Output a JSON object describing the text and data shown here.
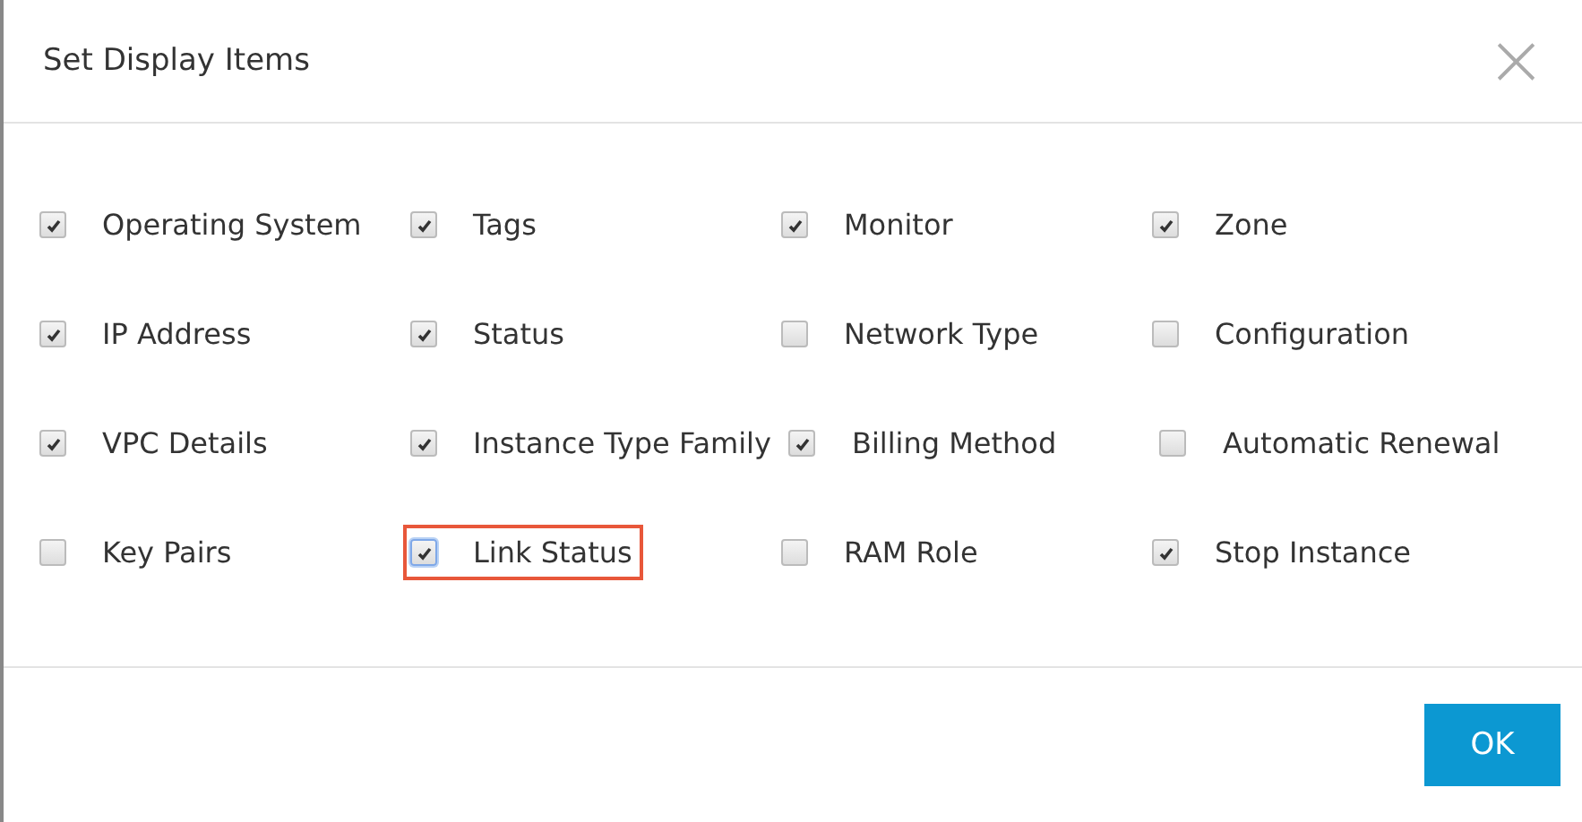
{
  "dialog": {
    "title": "Set Display Items",
    "close": "×"
  },
  "rows": [
    [
      {
        "label": "Operating System",
        "checked": true,
        "highlighted": false
      },
      {
        "label": "Tags",
        "checked": true,
        "highlighted": false
      },
      {
        "label": "Monitor",
        "checked": true,
        "highlighted": false
      },
      {
        "label": "Zone",
        "checked": true,
        "highlighted": false
      }
    ],
    [
      {
        "label": "IP Address",
        "checked": true,
        "highlighted": false
      },
      {
        "label": "Status",
        "checked": true,
        "highlighted": false
      },
      {
        "label": "Network Type",
        "checked": false,
        "highlighted": false
      },
      {
        "label": "Configuration",
        "checked": false,
        "highlighted": false
      }
    ],
    [
      {
        "label": "VPC Details",
        "checked": true,
        "highlighted": false
      },
      {
        "label": "Instance Type Family",
        "checked": true,
        "highlighted": false
      },
      {
        "label": "Billing Method",
        "checked": true,
        "highlighted": false
      },
      {
        "label": "Automatic Renewal",
        "checked": false,
        "highlighted": false
      }
    ],
    [
      {
        "label": "Key Pairs",
        "checked": false,
        "highlighted": false
      },
      {
        "label": "Link Status",
        "checked": true,
        "highlighted": true
      },
      {
        "label": "RAM Role",
        "checked": false,
        "highlighted": false
      },
      {
        "label": "Stop Instance",
        "checked": true,
        "highlighted": false
      }
    ]
  ],
  "buttons": [
    {
      "label": "OK"
    }
  ]
}
